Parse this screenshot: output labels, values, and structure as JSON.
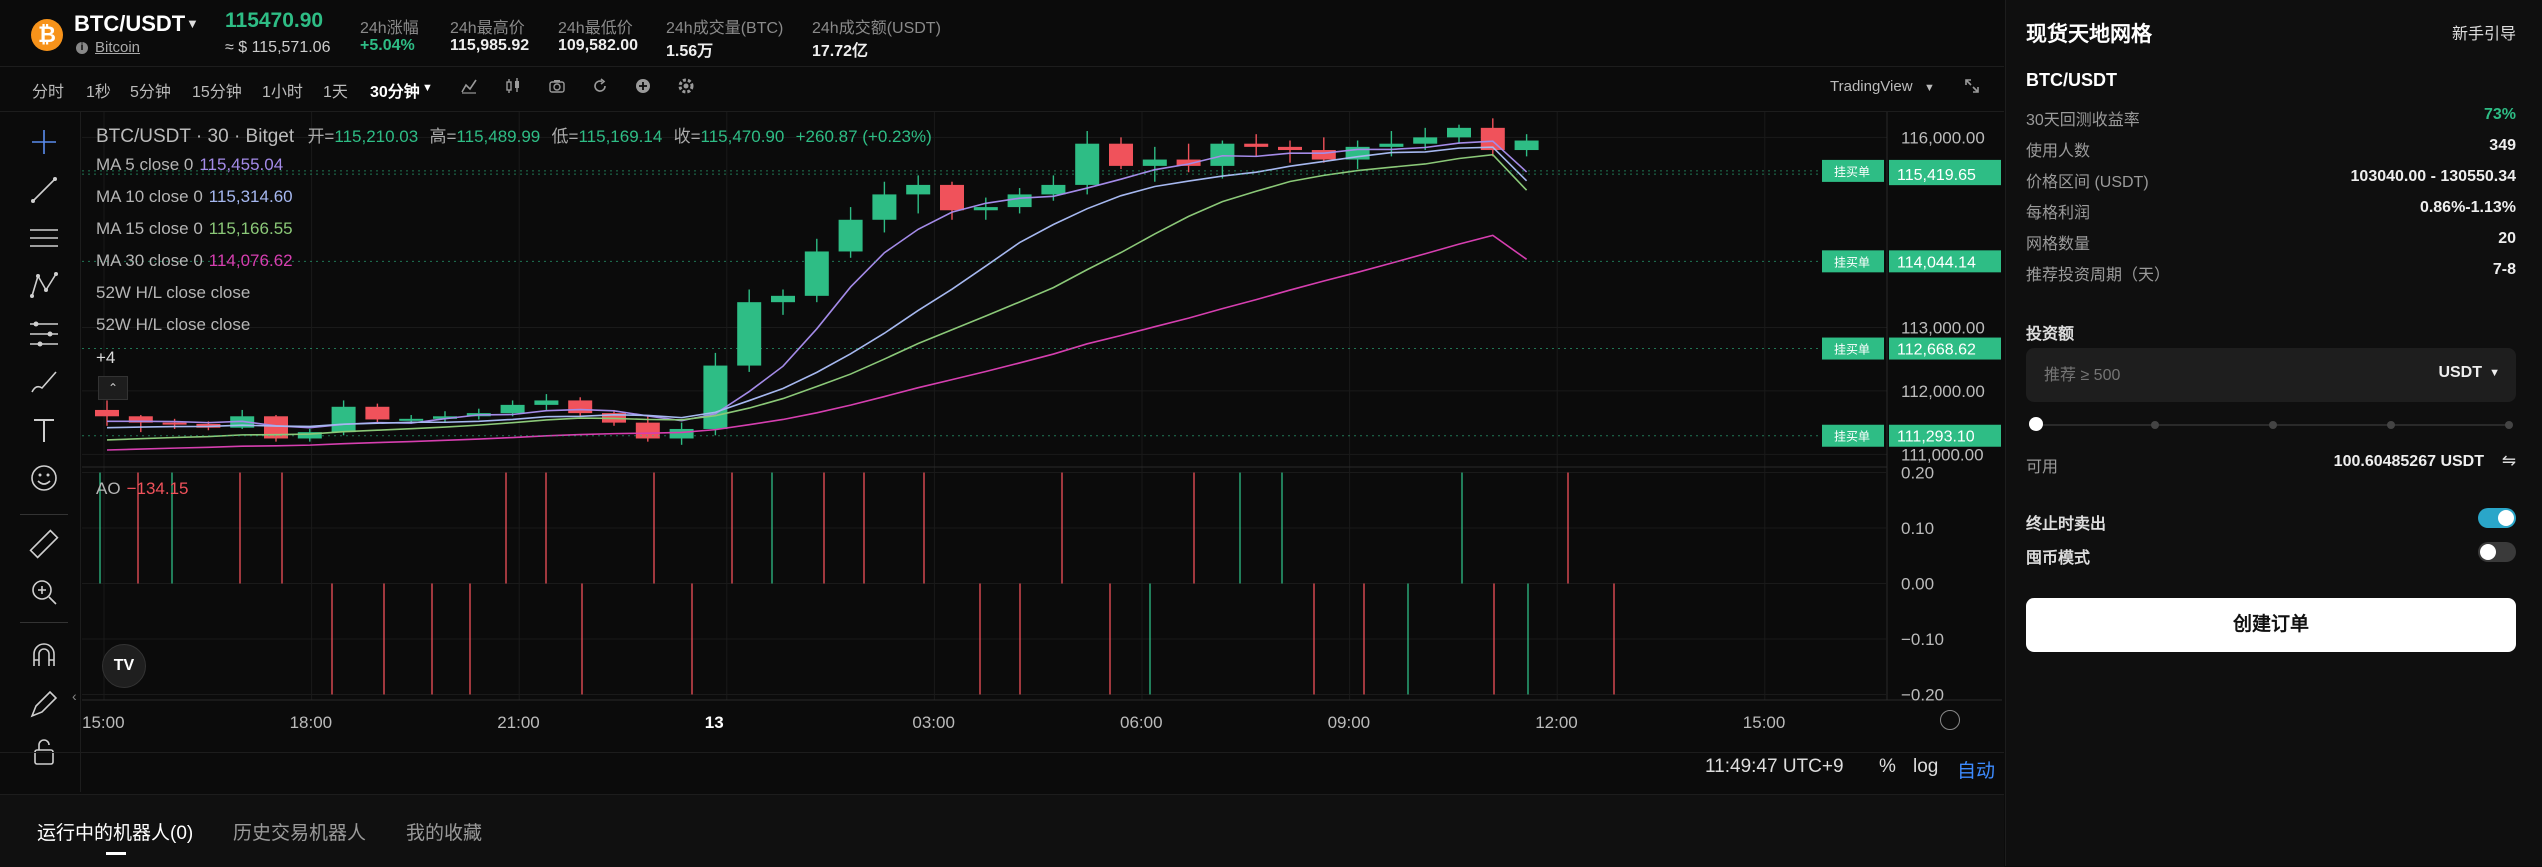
{
  "header": {
    "pair": "BTC/USDT",
    "coin_symbol": "₿",
    "coin_name": "Bitcoin",
    "last_price": "115470.90",
    "usd_price": "≈ $ 115,571.06",
    "stats": [
      {
        "label": "24h涨幅",
        "value": "+5.04%",
        "color": "#2ebd85"
      },
      {
        "label": "24h最高价",
        "value": "115,985.92",
        "color": "#eeeeee"
      },
      {
        "label": "24h最低价",
        "value": "109,582.00",
        "color": "#eeeeee"
      },
      {
        "label": "24h成交量(BTC)",
        "value": "1.56万",
        "color": "#eeeeee"
      },
      {
        "label": "24h成交额(USDT)",
        "value": "17.72亿",
        "color": "#eeeeee"
      }
    ]
  },
  "toolbar": {
    "intervals": [
      "分时",
      "1秒",
      "5分钟",
      "15分钟",
      "1小时",
      "1天"
    ],
    "active_interval": "30分钟",
    "source_label": "TradingView"
  },
  "chart": {
    "title_line": "BTC/USDT · 30 · Bitget",
    "ohlc": [
      {
        "k": "开=",
        "v": "115,210.03"
      },
      {
        "k": "高=",
        "v": "115,489.99"
      },
      {
        "k": "低=",
        "v": "115,169.14"
      },
      {
        "k": "收=",
        "v": "115,470.90"
      }
    ],
    "change": "+260.87 (+0.23%)",
    "indicators": [
      {
        "label": "MA 5 close 0",
        "value": "115,455.04",
        "color": "#a48be8"
      },
      {
        "label": "MA 10 close 0",
        "value": "115,314.60",
        "color": "#a6b8f0"
      },
      {
        "label": "MA 15 close 0",
        "value": "115,166.55",
        "color": "#8bc878"
      },
      {
        "label": "MA 30 close 0",
        "value": "114,076.62",
        "color": "#d63fb0"
      },
      {
        "label": "52W H/L close close",
        "value": "",
        "color": "#b5b5b5"
      },
      {
        "label": "52W H/L close close",
        "value": "",
        "color": "#b5b5b5"
      }
    ],
    "more_label": "+4",
    "ao_label": "AO",
    "ao_value": "−134.15",
    "colors": {
      "up": "#2ebd85",
      "down": "#f0525b"
    }
  },
  "chart_data": {
    "type": "candlestick",
    "title": "BTC/USDT · 30 · Bitget",
    "x_ticks": [
      "15:00",
      "18:00",
      "21:00",
      "13",
      "03:00",
      "06:00",
      "09:00",
      "12:00",
      "15:00"
    ],
    "y_ticks": [
      {
        "label": "116,000.00",
        "value": 116000
      },
      {
        "label": "113,000.00",
        "value": 113000
      },
      {
        "label": "112,000.00",
        "value": 112000
      },
      {
        "label": "111,000.00",
        "value": 111000
      }
    ],
    "ylim": [
      110800,
      116400
    ],
    "candles": [
      [
        111700,
        111850,
        111450,
        111600
      ],
      [
        111600,
        111620,
        111350,
        111500
      ],
      [
        111500,
        111560,
        111400,
        111480
      ],
      [
        111480,
        111520,
        111380,
        111420
      ],
      [
        111420,
        111700,
        111400,
        111600
      ],
      [
        111600,
        111620,
        111200,
        111250
      ],
      [
        111250,
        111400,
        111200,
        111350
      ],
      [
        111350,
        111850,
        111300,
        111750
      ],
      [
        111750,
        111800,
        111500,
        111550
      ],
      [
        111550,
        111620,
        111480,
        111560
      ],
      [
        111560,
        111680,
        111500,
        111600
      ],
      [
        111600,
        111720,
        111550,
        111650
      ],
      [
        111650,
        111850,
        111600,
        111780
      ],
      [
        111780,
        111950,
        111700,
        111850
      ],
      [
        111850,
        111900,
        111600,
        111650
      ],
      [
        111650,
        111700,
        111450,
        111500
      ],
      [
        111500,
        111600,
        111200,
        111250
      ],
      [
        111250,
        111500,
        111150,
        111400
      ],
      [
        111400,
        112600,
        111300,
        112400
      ],
      [
        112400,
        113600,
        112300,
        113400
      ],
      [
        113400,
        113600,
        113200,
        113500
      ],
      [
        113500,
        114400,
        113400,
        114200
      ],
      [
        114200,
        114900,
        114100,
        114700
      ],
      [
        114700,
        115300,
        114500,
        115100
      ],
      [
        115100,
        115400,
        114800,
        115250
      ],
      [
        115250,
        115300,
        114700,
        114850
      ],
      [
        114850,
        115050,
        114700,
        114900
      ],
      [
        114900,
        115200,
        114800,
        115100
      ],
      [
        115100,
        115400,
        115000,
        115250
      ],
      [
        115250,
        116100,
        115100,
        115900
      ],
      [
        115900,
        116000,
        115500,
        115550
      ],
      [
        115550,
        115850,
        115300,
        115650
      ],
      [
        115650,
        115900,
        115450,
        115550
      ],
      [
        115550,
        115950,
        115350,
        115900
      ],
      [
        115900,
        116050,
        115700,
        115850
      ],
      [
        115850,
        115950,
        115600,
        115800
      ],
      [
        115800,
        116000,
        115600,
        115650
      ],
      [
        115650,
        115950,
        115500,
        115850
      ],
      [
        115850,
        116100,
        115700,
        115900
      ],
      [
        115900,
        116150,
        115800,
        116000
      ],
      [
        116000,
        116200,
        115900,
        116150
      ],
      [
        116150,
        116300,
        115700,
        115800
      ],
      [
        115800,
        116050,
        115700,
        115950
      ]
    ],
    "ma_series": [
      {
        "name": "MA 5 close 0",
        "start": 111500,
        "end": 115455
      },
      {
        "name": "MA 10 close 0",
        "start": 111400,
        "end": 115314
      },
      {
        "name": "MA 15 close 0",
        "start": 111200,
        "end": 115166
      },
      {
        "name": "MA 30 close 0",
        "start": 111050,
        "end": 114076
      }
    ],
    "price_lines": [
      {
        "tag": "挂买单",
        "label": "115,470.90",
        "value": 115470.9
      },
      {
        "tag": "",
        "label": "115,419.65",
        "value": 115419.65
      },
      {
        "tag": "挂买单",
        "label": "114,044.14",
        "value": 114044.14
      },
      {
        "tag": "挂买单",
        "label": "112,668.62",
        "value": 112668.62
      },
      {
        "tag": "挂买单",
        "label": "111,293.10",
        "value": 111293.1
      }
    ],
    "ao_ticks": [
      {
        "label": "0.20",
        "value": 0.2
      },
      {
        "label": "0.10",
        "value": 0.1
      },
      {
        "label": "0.00",
        "value": 0.0
      },
      {
        "label": "−0.10",
        "value": -0.1
      },
      {
        "label": "−0.20",
        "value": -0.2
      }
    ],
    "ao_ylim": [
      -0.21,
      0.21
    ]
  },
  "bottom": {
    "time": "11:49:47 UTC+9",
    "pct_label": "%",
    "log_label": "log",
    "auto_label": "自动",
    "tabs": [
      "运行中的机器人(0)",
      "历史交易机器人",
      "我的收藏"
    ]
  },
  "panel": {
    "title": "现货天地网格",
    "guide_link": "新手引导",
    "pair": "BTC/USDT",
    "rows": [
      {
        "label": "30天回测收益率",
        "value": "73%",
        "color": "#2ebd85"
      },
      {
        "label": "使用人数",
        "value": "349",
        "color": "#eeeeee"
      },
      {
        "label": "价格区间 (USDT)",
        "value": "103040.00 - 130550.34",
        "color": "#eeeeee"
      },
      {
        "label": "每格利润",
        "value": "0.86%-1.13%",
        "color": "#eeeeee"
      },
      {
        "label": "网格数量",
        "value": "20",
        "color": "#eeeeee"
      },
      {
        "label": "推荐投资周期（天）",
        "value": "7-8",
        "color": "#eeeeee"
      }
    ],
    "invest_label": "投资额",
    "invest_placeholder": "推荐 ≥ 500",
    "invest_currency": "USDT",
    "slider_percent": 0,
    "available_label": "可用",
    "available_value": "100.60485267 USDT",
    "toggles": [
      {
        "label": "终止时卖出",
        "on": true
      },
      {
        "label": "囤币模式",
        "on": false
      }
    ],
    "create_button": "创建订单"
  }
}
